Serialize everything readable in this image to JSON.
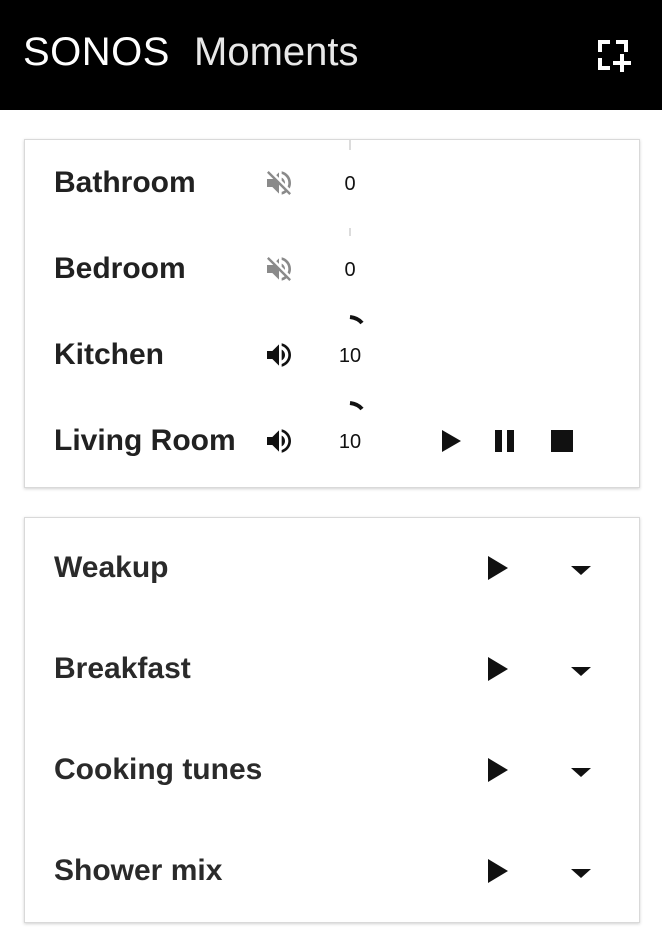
{
  "header": {
    "brand": "SONOS",
    "subtitle": "Moments",
    "add_icon": "add-fullscreen-icon"
  },
  "rooms": [
    {
      "name": "Bathroom",
      "muted": true,
      "volume": "0"
    },
    {
      "name": "Bedroom",
      "muted": true,
      "volume": "0"
    },
    {
      "name": "Kitchen",
      "muted": false,
      "volume": "10"
    },
    {
      "name": "Living Room",
      "muted": false,
      "volume": "10",
      "transport": [
        "play-icon",
        "pause-icon",
        "stop-icon"
      ]
    }
  ],
  "moments": [
    {
      "name": "Weakup"
    },
    {
      "name": "Breakfast"
    },
    {
      "name": "Cooking tunes"
    },
    {
      "name": "Shower mix"
    }
  ],
  "colors": {
    "header_bg": "#000000",
    "text": "#212121",
    "muted_icon": "#8a8a8a",
    "card_border": "#d9d9d9"
  }
}
